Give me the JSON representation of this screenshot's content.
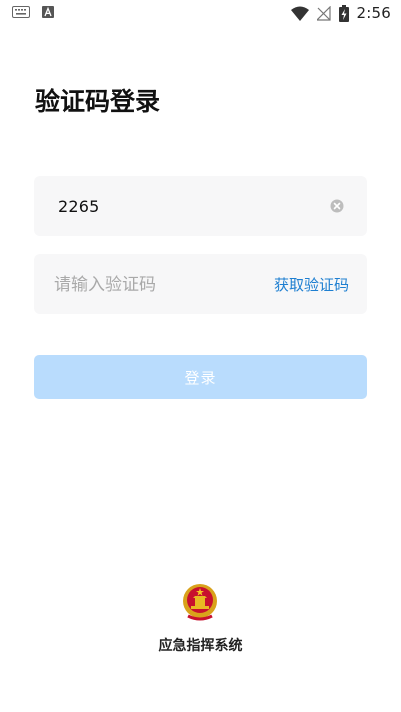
{
  "status_bar": {
    "time": "2:56",
    "left_icons": [
      "keyboard-icon",
      "font-a-icon"
    ],
    "right_icons": [
      "wifi-icon",
      "no-signal-icon",
      "battery-charging-icon"
    ]
  },
  "page": {
    "title": "验证码登录"
  },
  "form": {
    "phone_value": "2265",
    "code_placeholder": "请输入验证码",
    "get_code_label": "获取验证码",
    "login_label": "登录"
  },
  "footer": {
    "system_name": "应急指挥系统"
  },
  "colors": {
    "accent": "#1e7fd1",
    "button_disabled": "#b9dcfd",
    "field_bg": "#f7f7f8"
  }
}
